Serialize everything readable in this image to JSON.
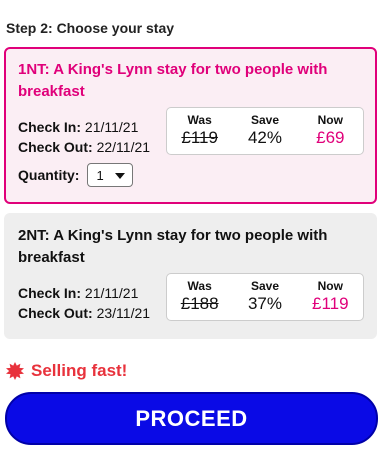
{
  "step_title": "Step 2: Choose your stay",
  "price_headers": {
    "was": "Was",
    "save": "Save",
    "now": "Now"
  },
  "offers": [
    {
      "title": "1NT: A King's Lynn stay for two people with breakfast",
      "check_in_label": "Check In:",
      "check_in": "21/11/21",
      "check_out_label": "Check Out:",
      "check_out": "22/11/21",
      "was": "£119",
      "save": "42%",
      "now": "£69",
      "selected": true,
      "quantity_label": "Quantity:",
      "quantity": "1"
    },
    {
      "title": "2NT: A King's Lynn stay for two people with breakfast",
      "check_in_label": "Check In:",
      "check_in": "21/11/21",
      "check_out_label": "Check Out:",
      "check_out": "23/11/21",
      "was": "£188",
      "save": "37%",
      "now": "£119",
      "selected": false
    }
  ],
  "urgency": {
    "icon": "starburst-icon",
    "text": "Selling fast!"
  },
  "proceed_label": "PROCEED",
  "colors": {
    "accent_pink": "#e0007a",
    "urgency_red": "#e8323c",
    "button_blue": "#0a0ae6"
  }
}
